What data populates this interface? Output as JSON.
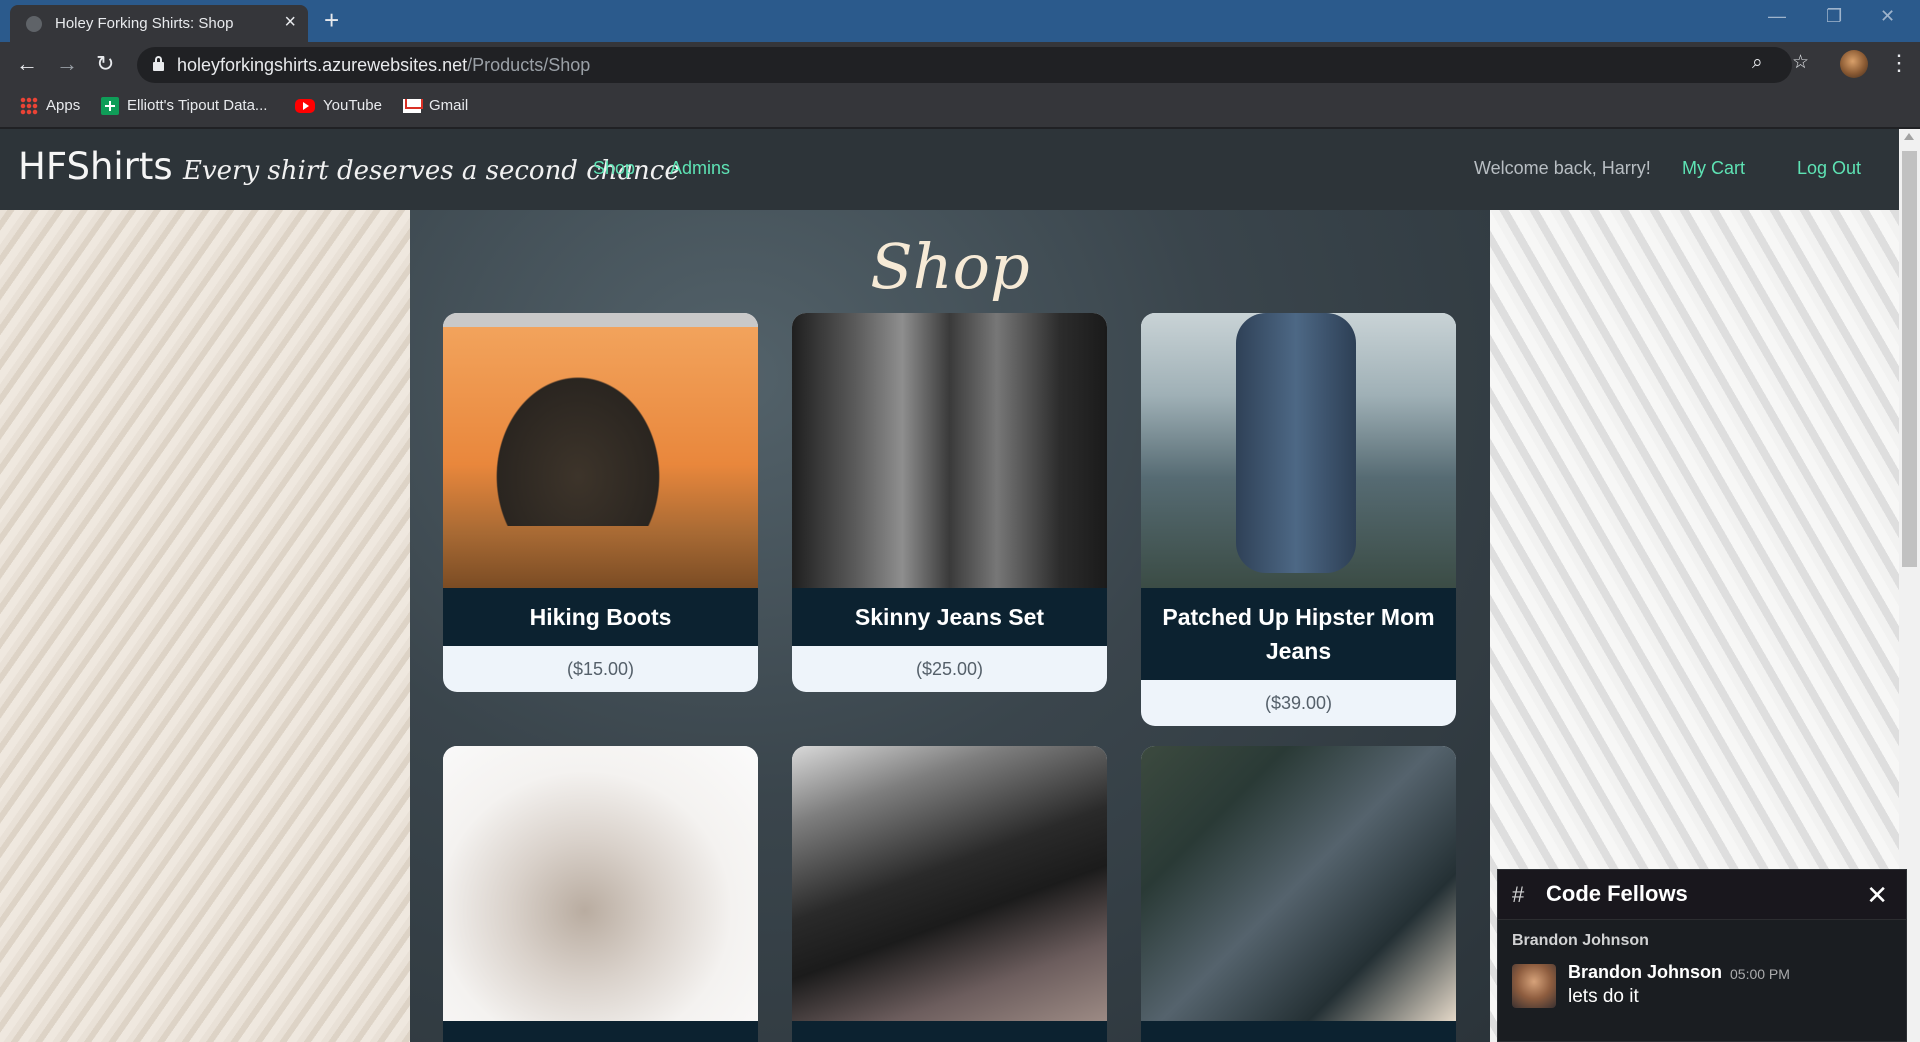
{
  "browser": {
    "tab_title": "Holey Forking Shirts: Shop",
    "url_host": "holeyforkingshirts.azurewebsites.net",
    "url_path": "/Products/Shop",
    "bookmarks": [
      {
        "label": "Apps",
        "icon": "apps-grid-icon"
      },
      {
        "label": "Elliott's Tipout Data...",
        "icon": "sheets-icon"
      },
      {
        "label": "YouTube",
        "icon": "youtube-icon"
      },
      {
        "label": "Gmail",
        "icon": "gmail-icon"
      }
    ]
  },
  "site": {
    "brand": "HFShirts",
    "tagline": "Every shirt deserves a second chance",
    "nav": {
      "shop": "Shop",
      "admins": "Admins",
      "my_cart": "My Cart",
      "log_out": "Log Out"
    },
    "welcome": "Welcome back, Harry!",
    "accent_color": "#5ee3b4"
  },
  "shop": {
    "heading": "Shop",
    "products": [
      {
        "name": "Hiking Boots",
        "price": "($15.00)"
      },
      {
        "name": "Skinny Jeans Set",
        "price": "($25.00)"
      },
      {
        "name": "Patched Up Hipster Mom Jeans",
        "price": "($39.00)"
      }
    ]
  },
  "notification": {
    "workspace": "Code Fellows",
    "from": "Brandon Johnson",
    "sender": "Brandon Johnson",
    "time": "05:00 PM",
    "message": "lets do it"
  }
}
